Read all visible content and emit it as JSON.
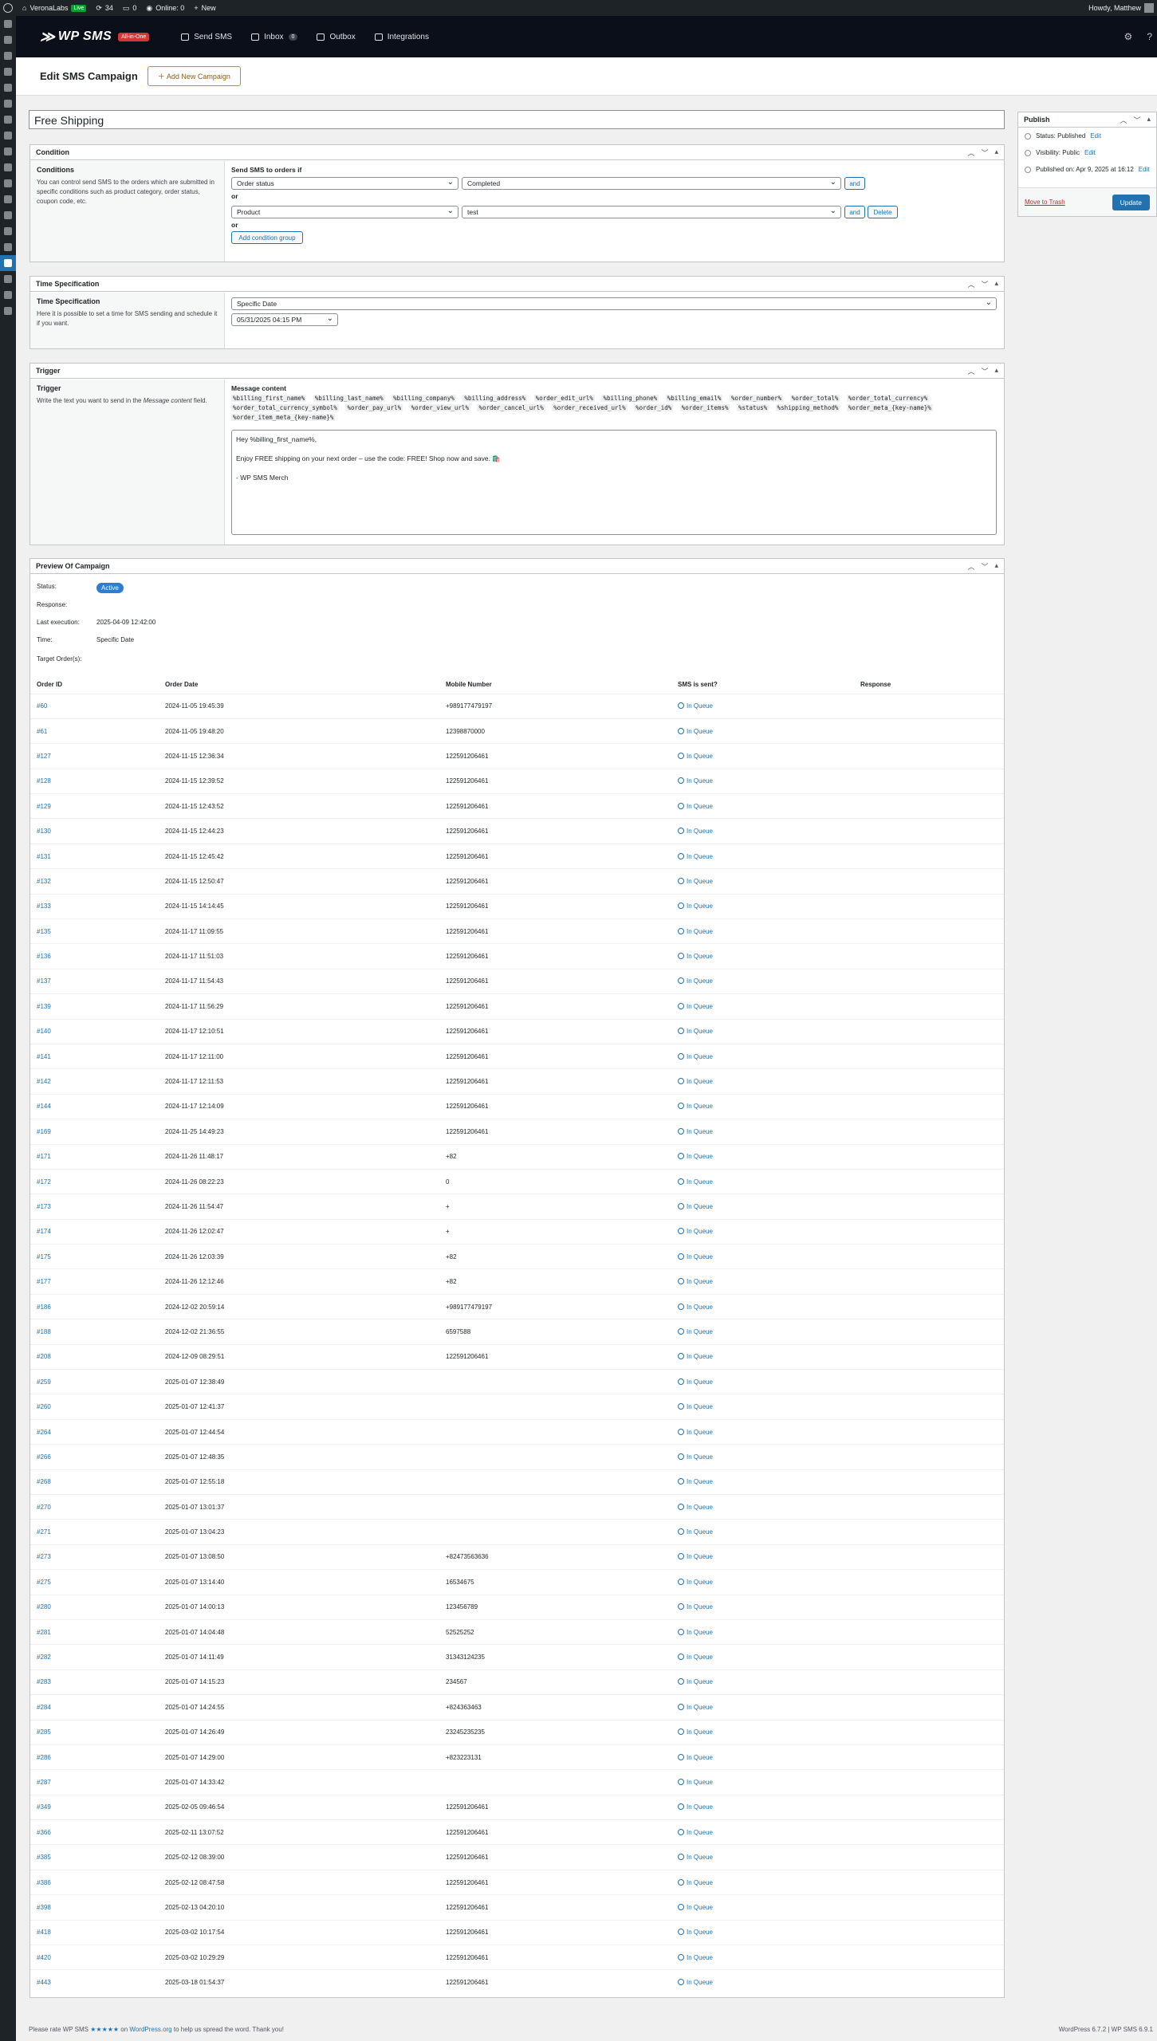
{
  "adminbar": {
    "site": "VeronaLabs",
    "live": "Live",
    "updates": "34",
    "comments": "0",
    "online": "Online: 0",
    "new": "New",
    "howdy": "Howdy, Matthew"
  },
  "header": {
    "logo_name": "WP SMS",
    "badge": "All-in-One",
    "nav": [
      {
        "label": "Send SMS"
      },
      {
        "label": "Inbox",
        "count": "0"
      },
      {
        "label": "Outbox"
      },
      {
        "label": "Integrations"
      }
    ]
  },
  "page": {
    "title": "Edit SMS Campaign",
    "add_new": "Add New Campaign",
    "campaign_title": "Free Shipping"
  },
  "condition": {
    "heading": "Condition",
    "side_title": "Conditions",
    "side_desc": "You can control send SMS to the orders which are submitted in specific conditions such as product category, order status, coupon code, etc.",
    "send_label": "Send SMS to orders if",
    "row1": {
      "field": "Order status",
      "value": "Completed",
      "and": "and"
    },
    "or1": "or",
    "row2": {
      "field": "Product",
      "value": "test",
      "and": "and",
      "delete": "Delete"
    },
    "or2": "or",
    "add_group": "Add condition group"
  },
  "time": {
    "heading": "Time Specification",
    "side_title": "Time Specification",
    "side_desc": "Here it is possible to set a time for SMS sending and schedule it if you want.",
    "type": "Specific Date",
    "datetime": "05/31/2025 04:15 PM"
  },
  "trigger": {
    "heading": "Trigger",
    "side_title": "Trigger",
    "side_desc_pre": "Write the text you want to send in the ",
    "side_desc_em": "Message content",
    "side_desc_post": " field.",
    "message_label": "Message content",
    "tags": [
      "%billing_first_name%",
      "%billing_last_name%",
      "%billing_company%",
      "%billing_address%",
      "%order_edit_url%",
      "%billing_phone%",
      "%billing_email%",
      "%order_number%",
      "%order_total%",
      "%order_total_currency%",
      "%order_total_currency_symbol%",
      "%order_pay_url%",
      "%order_view_url%",
      "%order_cancel_url%",
      "%order_received_url%",
      "%order_id%",
      "%order_items%",
      "%status%",
      "%shipping_method%",
      "%order_meta_{key-name}%",
      "%order_item_meta_{key-name}%"
    ],
    "message": "Hey %billing_first_name%,\n\nEnjoy FREE shipping on your next order – use the code: FREE! Shop now and save. 🛍️\n\n- WP SMS Merch"
  },
  "preview": {
    "heading": "Preview Of Campaign",
    "status_label": "Status:",
    "status": "Active",
    "response_label": "Response:",
    "last_exec_label": "Last execution:",
    "last_exec": "2025-04-09 12:42:00",
    "time_label": "Time:",
    "time": "Specific Date",
    "target_label": "Target Order(s):",
    "columns": [
      "Order ID",
      "Order Date",
      "Mobile Number",
      "SMS is sent?",
      "Response"
    ],
    "rows": [
      [
        "#60",
        "2024-11-05 19:45:39",
        "+989177479197",
        "In Queue"
      ],
      [
        "#61",
        "2024-11-05 19:48:20",
        "12398870000",
        "In Queue"
      ],
      [
        "#127",
        "2024-11-15 12:36:34",
        "122591206461",
        "In Queue"
      ],
      [
        "#128",
        "2024-11-15 12:39:52",
        "122591206461",
        "In Queue"
      ],
      [
        "#129",
        "2024-11-15 12:43:52",
        "122591206461",
        "In Queue"
      ],
      [
        "#130",
        "2024-11-15 12:44:23",
        "122591206461",
        "In Queue"
      ],
      [
        "#131",
        "2024-11-15 12:45:42",
        "122591206461",
        "In Queue"
      ],
      [
        "#132",
        "2024-11-15 12:50:47",
        "122591206461",
        "In Queue"
      ],
      [
        "#133",
        "2024-11-15 14:14:45",
        "122591206461",
        "In Queue"
      ],
      [
        "#135",
        "2024-11-17 11:09:55",
        "122591206461",
        "In Queue"
      ],
      [
        "#136",
        "2024-11-17 11:51:03",
        "122591206461",
        "In Queue"
      ],
      [
        "#137",
        "2024-11-17 11:54:43",
        "122591206461",
        "In Queue"
      ],
      [
        "#139",
        "2024-11-17 11:56:29",
        "122591206461",
        "In Queue"
      ],
      [
        "#140",
        "2024-11-17 12:10:51",
        "122591206461",
        "In Queue"
      ],
      [
        "#141",
        "2024-11-17 12:11:00",
        "122591206461",
        "In Queue"
      ],
      [
        "#142",
        "2024-11-17 12:11:53",
        "122591206461",
        "In Queue"
      ],
      [
        "#144",
        "2024-11-17 12:14:09",
        "122591206461",
        "In Queue"
      ],
      [
        "#169",
        "2024-11-25 14:49:23",
        "122591206461",
        "In Queue"
      ],
      [
        "#171",
        "2024-11-26 11:48:17",
        "+82",
        "In Queue"
      ],
      [
        "#172",
        "2024-11-26 08:22:23",
        "0",
        "In Queue"
      ],
      [
        "#173",
        "2024-11-26 11:54:47",
        "+",
        "In Queue"
      ],
      [
        "#174",
        "2024-11-26 12:02:47",
        "+",
        "In Queue"
      ],
      [
        "#175",
        "2024-11-26 12:03:39",
        "+82",
        "In Queue"
      ],
      [
        "#177",
        "2024-11-26 12:12:46",
        "+82",
        "In Queue"
      ],
      [
        "#186",
        "2024-12-02 20:59:14",
        "+989177479197",
        "In Queue"
      ],
      [
        "#188",
        "2024-12-02 21:36:55",
        "6597588",
        "In Queue"
      ],
      [
        "#208",
        "2024-12-09 08:29:51",
        "122591206461",
        "In Queue"
      ],
      [
        "#259",
        "2025-01-07 12:38:49",
        "",
        "In Queue"
      ],
      [
        "#260",
        "2025-01-07 12:41:37",
        "",
        "In Queue"
      ],
      [
        "#264",
        "2025-01-07 12:44:54",
        "",
        "In Queue"
      ],
      [
        "#266",
        "2025-01-07 12:48:35",
        "",
        "In Queue"
      ],
      [
        "#268",
        "2025-01-07 12:55:18",
        "",
        "In Queue"
      ],
      [
        "#270",
        "2025-01-07 13:01:37",
        "",
        "In Queue"
      ],
      [
        "#271",
        "2025-01-07 13:04:23",
        "",
        "In Queue"
      ],
      [
        "#273",
        "2025-01-07 13:08:50",
        "+82473563636",
        "In Queue"
      ],
      [
        "#275",
        "2025-01-07 13:14:40",
        "16534675",
        "In Queue"
      ],
      [
        "#280",
        "2025-01-07 14:00:13",
        "123456789",
        "In Queue"
      ],
      [
        "#281",
        "2025-01-07 14:04:48",
        "52525252",
        "In Queue"
      ],
      [
        "#282",
        "2025-01-07 14:11:49",
        "31343124235",
        "In Queue"
      ],
      [
        "#283",
        "2025-01-07 14:15:23",
        "234567",
        "In Queue"
      ],
      [
        "#284",
        "2025-01-07 14:24:55",
        "+824363463",
        "In Queue"
      ],
      [
        "#285",
        "2025-01-07 14:26:49",
        "23245235235",
        "In Queue"
      ],
      [
        "#286",
        "2025-01-07 14:29:00",
        "+823223131",
        "In Queue"
      ],
      [
        "#287",
        "2025-01-07 14:33:42",
        "",
        "In Queue"
      ],
      [
        "#349",
        "2025-02-05 09:46:54",
        "122591206461",
        "In Queue"
      ],
      [
        "#366",
        "2025-02-11 13:07:52",
        "122591206461",
        "In Queue"
      ],
      [
        "#385",
        "2025-02-12 08:39:00",
        "122591206461",
        "In Queue"
      ],
      [
        "#386",
        "2025-02-12 08:47:58",
        "122591206461",
        "In Queue"
      ],
      [
        "#398",
        "2025-02-13 04:20:10",
        "122591206461",
        "In Queue"
      ],
      [
        "#418",
        "2025-03-02 10:17:54",
        "122591206461",
        "In Queue"
      ],
      [
        "#420",
        "2025-03-02 10:29:29",
        "122591206461",
        "In Queue"
      ],
      [
        "#443",
        "2025-03-18 01:54:37",
        "122591206461",
        "In Queue"
      ]
    ]
  },
  "publish": {
    "heading": "Publish",
    "status": "Status: Published",
    "status_edit": "Edit",
    "visibility": "Visibility: Public",
    "visibility_edit": "Edit",
    "published_on": "Published on: Apr 9, 2025 at 16:12",
    "published_edit": "Edit",
    "trash": "Move to Trash",
    "update": "Update"
  },
  "footer": {
    "left_pre": "Please rate WP SMS ",
    "stars": "★★★★★",
    "left_mid": " on ",
    "link": "WordPress.org",
    "left_post": " to help us spread the word. Thank you!",
    "right": "WordPress 6.7.2 | WP SMS 6.9.1"
  }
}
